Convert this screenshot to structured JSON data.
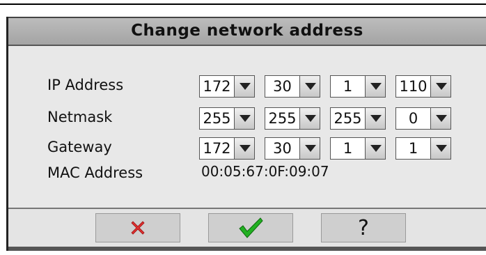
{
  "dialog": {
    "title": "Change network address"
  },
  "rows": {
    "ip": {
      "label": "IP Address",
      "octets": [
        "172",
        "30",
        "1",
        "110"
      ]
    },
    "netmask": {
      "label": "Netmask",
      "octets": [
        "255",
        "255",
        "255",
        "0"
      ]
    },
    "gateway": {
      "label": "Gateway",
      "octets": [
        "172",
        "30",
        "1",
        "1"
      ]
    },
    "mac": {
      "label": "MAC Address",
      "value": "00:05:67:0F:09:07"
    }
  },
  "buttons": {
    "cancel_icon": "cancel-x-icon",
    "ok_icon": "checkmark-icon",
    "help_label": "?"
  },
  "colors": {
    "cancel": "#e03030",
    "ok": "#22b022"
  }
}
